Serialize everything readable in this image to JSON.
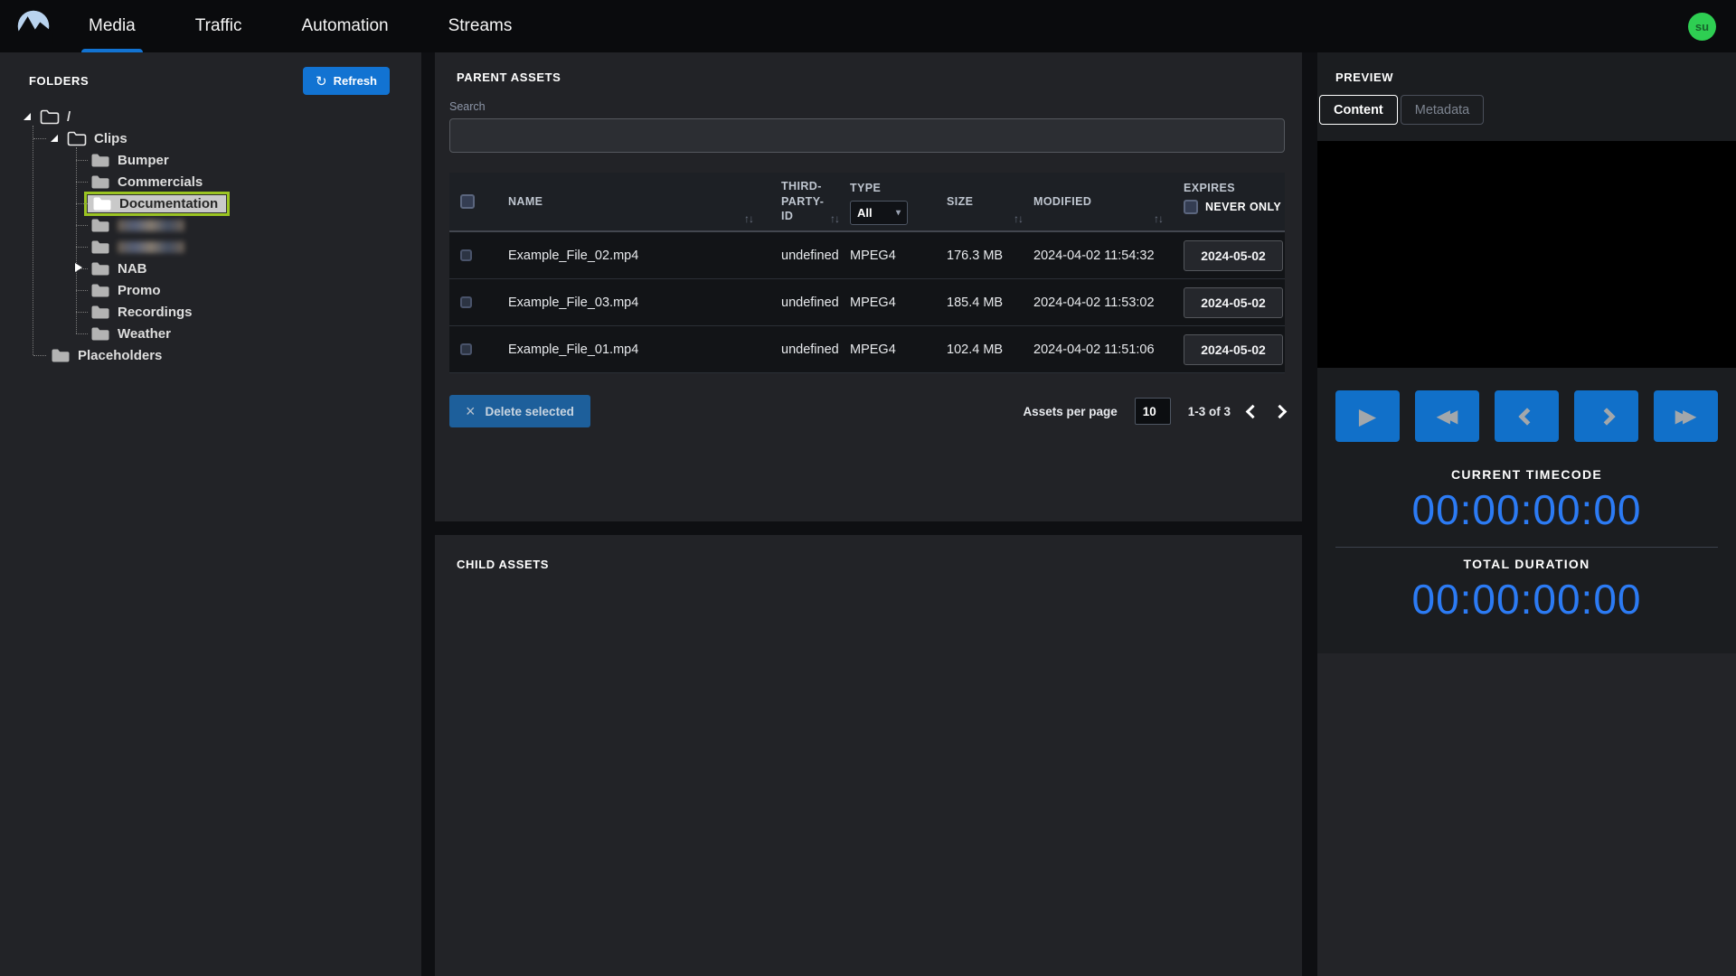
{
  "nav": {
    "tabs": [
      {
        "label": "Media",
        "active": true
      },
      {
        "label": "Traffic",
        "active": false
      },
      {
        "label": "Automation",
        "active": false
      },
      {
        "label": "Streams",
        "active": false
      }
    ],
    "avatar_initials": "su"
  },
  "folders": {
    "title": "FOLDERS",
    "refresh_button": "Refresh",
    "tree": [
      {
        "label": "/",
        "depth": 0,
        "expander": "expanded",
        "icon_style": "outline"
      },
      {
        "label": "Clips",
        "depth": 1,
        "expander": "expanded",
        "icon_style": "outline"
      },
      {
        "label": "Bumper",
        "depth": 2,
        "icon_style": "filled"
      },
      {
        "label": "Commercials",
        "depth": 2,
        "icon_style": "filled"
      },
      {
        "label": "Documentation",
        "depth": 2,
        "icon_style": "white",
        "selected": true
      },
      {
        "label": "",
        "depth": 2,
        "icon_style": "filled",
        "redacted": true
      },
      {
        "label": "",
        "depth": 2,
        "icon_style": "filled",
        "redacted": true
      },
      {
        "label": "NAB",
        "depth": 2,
        "expander": "collapsed",
        "icon_style": "filled"
      },
      {
        "label": "Promo",
        "depth": 2,
        "icon_style": "filled"
      },
      {
        "label": "Recordings",
        "depth": 2,
        "icon_style": "filled"
      },
      {
        "label": "Weather",
        "depth": 2,
        "icon_style": "filled"
      },
      {
        "label": "Placeholders",
        "depth": 1,
        "icon_style": "filled"
      }
    ]
  },
  "parent_assets": {
    "title": "PARENT ASSETS",
    "search_label": "Search",
    "search_value": "",
    "columns": {
      "name": "NAME",
      "third_party_id": "THIRD-PARTY-ID",
      "type": "TYPE",
      "size": "SIZE",
      "modified": "MODIFIED",
      "expires": "EXPIRES"
    },
    "type_filter_value": "All",
    "never_only_label": "NEVER ONLY",
    "rows": [
      {
        "name": "Example_File_02.mp4",
        "third_party_id": "undefined",
        "type": "MPEG4",
        "size": "176.3 MB",
        "modified": "2024-04-02 11:54:32",
        "expires": "2024-05-02"
      },
      {
        "name": "Example_File_03.mp4",
        "third_party_id": "undefined",
        "type": "MPEG4",
        "size": "185.4 MB",
        "modified": "2024-04-02 11:53:02",
        "expires": "2024-05-02"
      },
      {
        "name": "Example_File_01.mp4",
        "third_party_id": "undefined",
        "type": "MPEG4",
        "size": "102.4 MB",
        "modified": "2024-04-02 11:51:06",
        "expires": "2024-05-02"
      }
    ],
    "footer": {
      "delete_button": "Delete selected",
      "per_page_label": "Assets per page",
      "per_page_value": "10",
      "range": "1-3 of 3"
    }
  },
  "child_assets": {
    "title": "CHILD ASSETS"
  },
  "preview": {
    "title": "PREVIEW",
    "tabs": [
      {
        "label": "Content",
        "active": true
      },
      {
        "label": "Metadata",
        "active": false
      }
    ],
    "current_timecode_label": "CURRENT TIMECODE",
    "current_timecode": "00:00:00:00",
    "total_duration_label": "TOTAL DURATION",
    "total_duration": "00:00:00:00"
  },
  "icons": {
    "refresh": "↻",
    "sort": "↑↓",
    "delete": "×",
    "dropdown_caret": "▾",
    "play": "▶",
    "rewind": "◀◀",
    "fast_forward": "▶▶"
  },
  "colors": {
    "accent_blue": "#1273d2",
    "timecode_blue": "#2c7bf4",
    "selection_green": "#9bc422",
    "avatar_green": "#2ece52"
  }
}
